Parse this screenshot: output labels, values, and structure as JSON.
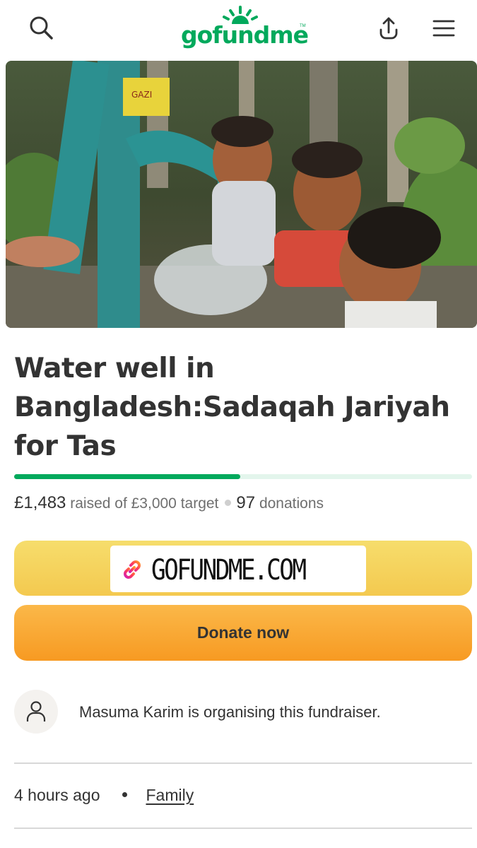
{
  "header": {
    "logo_text": "gofundme",
    "logo_tm": "TM",
    "brand_color": "#02a95c",
    "icons": [
      "search-icon",
      "share-upload-icon",
      "hamburger-menu-icon"
    ]
  },
  "hero": {
    "pump_label": "GAZI"
  },
  "campaign": {
    "title": "Water well in Bangladesh:Sadaqah Jariyah for Tas",
    "progress_fraction": 0.494,
    "raised_amount": "£1,483",
    "raised_label": "raised of £3,000 target",
    "donation_count": "97",
    "donations_label": "donations"
  },
  "link_banner": {
    "text": "GOFUNDME.COM",
    "icon": "link-icon"
  },
  "donate_button": {
    "label": "Donate now"
  },
  "organiser": {
    "text": "Masuma Karim is organising this fundraiser.",
    "icon": "user-icon"
  },
  "meta": {
    "time": "4 hours ago",
    "category": "Family"
  },
  "colors": {
    "accent_green": "#02a95c",
    "donate_orange": "#f79a22",
    "banner_yellow": "#f4c94f"
  }
}
